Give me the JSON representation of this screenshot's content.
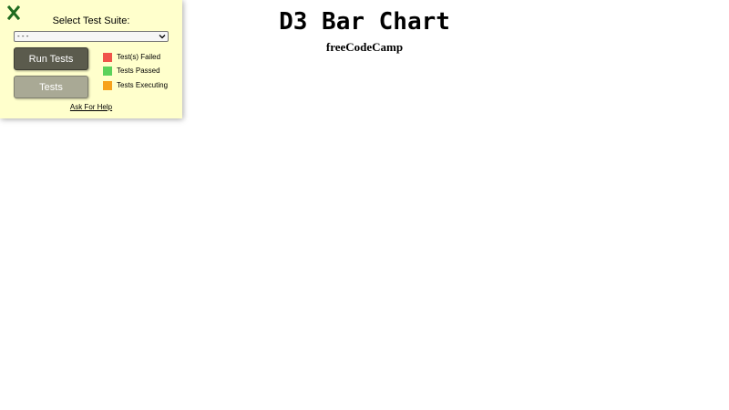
{
  "page": {
    "title": "D3 Bar Chart",
    "subtitle": "freeCodeCamp"
  },
  "test_panel": {
    "close_icon": "close-icon",
    "select_label": "Select Test Suite:",
    "select_value": "- - -",
    "run_tests_label": "Run Tests",
    "tests_label": "Tests",
    "legend": [
      {
        "label": "Test(s) Failed",
        "color": "#f0544a"
      },
      {
        "label": "Tests Passed",
        "color": "#5bd25b"
      },
      {
        "label": "Tests Executing",
        "color": "#f7a21b"
      }
    ],
    "help_link": "Ask For Help",
    "colors": {
      "panel_bg": "#ffffcc",
      "close_icon": "#1f6b1f",
      "run_button_bg": "#5b5b4d",
      "tests_button_bg": "#a9a995"
    }
  }
}
